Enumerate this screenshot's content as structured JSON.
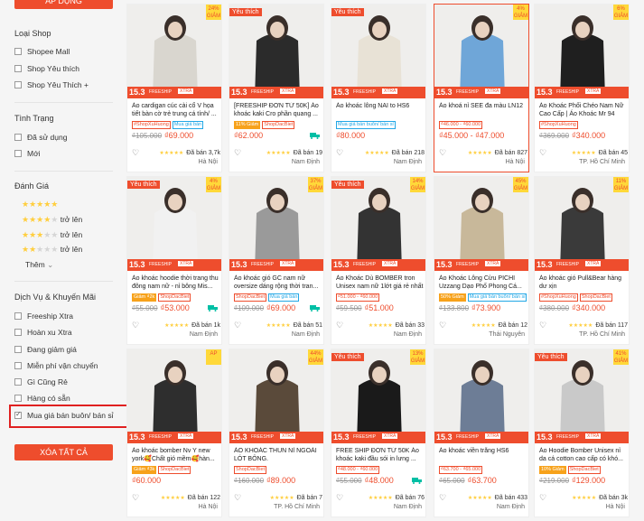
{
  "sidebar": {
    "apply_label": "ÁP DỤNG",
    "groups": [
      {
        "title": "Loại Shop",
        "items": [
          "Shopee Mall",
          "Shop Yêu thích",
          "Shop Yêu Thích +"
        ]
      },
      {
        "title": "Tình Trạng",
        "items": [
          "Đã sử dụng",
          "Mới"
        ]
      },
      {
        "title": "Đánh Giá",
        "ratings": [
          {
            "stars": 5,
            "label": ""
          },
          {
            "stars": 4,
            "label": "trở lên"
          },
          {
            "stars": 3,
            "label": "trở lên"
          },
          {
            "stars": 2,
            "label": "trở lên"
          }
        ],
        "more_label": "Thêm"
      },
      {
        "title": "Dịch Vụ & Khuyến Mãi",
        "items": [
          "Freeship Xtra",
          "Hoàn xu Xtra",
          "Đang giảm giá",
          "Miễn phí vận chuyển",
          "Gì Cũng Rẻ",
          "Hàng có sẵn",
          "Mua giá bán buôn/ bán sỉ"
        ],
        "checked": "Mua giá bán buôn/ bán sỉ"
      }
    ],
    "clear_label": "XÓA TẤT CẢ"
  },
  "promo": {
    "p1": "15.3",
    "p2": "FREESHIP",
    "p3": "XTRA"
  },
  "products": [
    {
      "yt": "",
      "disc": "24%\nGIẢM",
      "name": "Áo cardigan cúc cài cổ V họa tiết bàn cờ trẻ trung cá tính/ ...",
      "tags": [
        "#ShopXuHuong",
        "Mua giá bán"
      ],
      "old": "₫105.000",
      "new": "₫69.000",
      "sold": "Đã bán 3,7k",
      "loc": "Hà Nội",
      "truck": false,
      "img": "#d9d6cf"
    },
    {
      "yt": "Yêu thích",
      "disc": "",
      "name": "[FREESHIP ĐƠN TỪ 50K] Áo khoác kaki Cro phần quang ...",
      "tags": [
        "11% Giảm",
        "ShopDacBiet"
      ],
      "old": "",
      "new": "₫62.000",
      "sold": "Đã bán 19",
      "loc": "Nam Định",
      "truck": true,
      "img": "#2b2b2b"
    },
    {
      "yt": "Yêu thích",
      "disc": "",
      "name": "Áo khoác lông NAI to HS6",
      "tags": [
        "Mua giá bán buôn/ bán sỉ"
      ],
      "old": "",
      "new": "₫80.000",
      "sold": "Đã bán 218",
      "loc": "Nam Định",
      "truck": false,
      "img": "#e8e2d6"
    },
    {
      "yt": "",
      "disc": "4%\nGIẢM",
      "name": "Áo khoá nỉ SEE đa màu LN12",
      "tags": [
        "₫46.000 - ₫60.000"
      ],
      "old": "",
      "new": "₫45.000 - ₫47.000",
      "sold": "Đã bán 827",
      "loc": "Hà Nội",
      "truck": false,
      "img": "#6fa6d8",
      "selected": true
    },
    {
      "yt": "",
      "disc": "6%\nGIẢM",
      "name": "Áo Khoác Phối Chéo Nam Nữ Cao Cấp | Áo Khoác Mr 94",
      "tags": [
        "#ShopXuHuong"
      ],
      "old": "₫369.000",
      "new": "₫340.000",
      "sold": "Đã bán 45",
      "loc": "TP. Hồ Chí Minh",
      "truck": false,
      "img": "#1f1f1f"
    },
    {
      "yt": "Yêu thích",
      "disc": "4%\nGIẢM",
      "name": "Áo khoác hoodie thời trang thu đông nam nữ - nỉ bông Mis...",
      "tags": [
        "Giảm ₫2k",
        "ShopDacBiet"
      ],
      "old": "₫55.000",
      "new": "₫53.000",
      "sold": "Đã bán 1k",
      "loc": "Nam Định",
      "truck": true,
      "img": "#f1f1f1"
    },
    {
      "yt": "",
      "disc": "37%\nGIẢM",
      "name": "Áo khoác gió GC nam nữ oversize dáng rộng thời tran...",
      "tags": [
        "ShopDacBiet",
        "Mua giá bán"
      ],
      "old": "₫109.000",
      "new": "₫69.000",
      "sold": "Đã bán 51",
      "loc": "Nam Định",
      "truck": true,
      "img": "#9a9a9a"
    },
    {
      "yt": "Yêu thích",
      "disc": "14%\nGIẢM",
      "name": "Áo Khoác Dù BOMBER tron Unisex nam nữ 1lớt giá rẻ nhất",
      "tags": [
        "₫51.000 - ₫60.000"
      ],
      "old": "₫59.500",
      "new": "₫51.000",
      "sold": "Đã bán 33",
      "loc": "Nam Định",
      "truck": false,
      "img": "#333333"
    },
    {
      "yt": "",
      "disc": "45%\nGIẢM",
      "name": "Áo Khoác Lông Cừu PICHI Uzzang Dạo Phố Phong Cá...",
      "tags": [
        "50% Giảm",
        "Mua giá bán buôn/ bán sỉ"
      ],
      "old": "₫133.800",
      "new": "₫73.900",
      "sold": "Đã bán 12",
      "loc": "Thái Nguyên",
      "truck": false,
      "img": "#c8b89a"
    },
    {
      "yt": "",
      "disc": "11%\nGIẢM",
      "name": "Áo khoác gió Pull&Bear hàng dư xịn",
      "tags": [
        "#ShopXuHuong",
        "ShopDacBiet"
      ],
      "old": "₫380.000",
      "new": "₫340.000",
      "sold": "Đã bán 117",
      "loc": "TP. Hồ Chí Minh",
      "truck": false,
      "img": "#3a3a3a"
    },
    {
      "yt": "",
      "disc": "AP",
      "name": "Áo khoác bomber Nv Y new york🥰Chất gió mềm🥰hàn...",
      "tags": [
        "Giảm ₫3k",
        "ShopDacBiet"
      ],
      "old": "",
      "new": "₫60.000",
      "sold": "Đã bán 122",
      "loc": "Hà Nội",
      "truck": false,
      "img": "#2e2e2e"
    },
    {
      "yt": "",
      "disc": "44%\nGIẢM",
      "name": "ÁO KHOÁC THUN NỈ NGOÀI LÓT BÔNG.",
      "tags": [
        "ShopDacBiet"
      ],
      "old": "₫160.000",
      "new": "₫89.000",
      "sold": "Đã bán 7",
      "loc": "TP. Hồ Chí Minh",
      "truck": false,
      "img": "#5a4a3a"
    },
    {
      "yt": "Yêu thích",
      "disc": "13%\nGIẢM",
      "name": "FREE SHIP ĐƠN TỪ 50K Áo khoác kaki đầu sói in lưng ...",
      "tags": [
        "₫48.000 - ₫60.000"
      ],
      "old": "₫55.000",
      "new": "₫48.000",
      "sold": "Đã bán 76",
      "loc": "Nam Định",
      "truck": true,
      "img": "#1a1a1a"
    },
    {
      "yt": "",
      "disc": "",
      "name": "Áo khoác viền trắng HS6",
      "tags": [
        "₫63.700 - ₫65.000"
      ],
      "old": "₫65.000",
      "new": "₫63.700",
      "sold": "Đã bán 433",
      "loc": "Nam Định",
      "truck": false,
      "img": "#6d7d96"
    },
    {
      "yt": "Yêu thích",
      "disc": "41%\nGIẢM",
      "name": "Áo Hoodie Bomber Unisex nỉ da cá cotton cao cấp có khó...",
      "tags": [
        "10% Giảm",
        "ShopDacBiet"
      ],
      "old": "₫219.000",
      "new": "₫129.000",
      "sold": "Đã bán 3k",
      "loc": "Hà Nội",
      "truck": false,
      "img": "#c9c9c9"
    }
  ]
}
